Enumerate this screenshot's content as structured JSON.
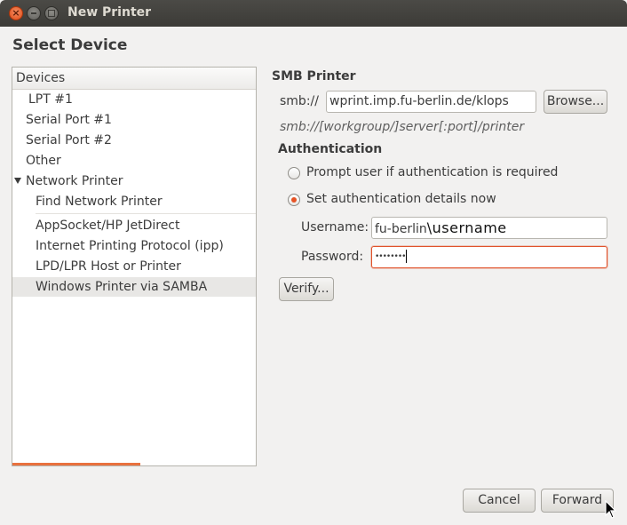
{
  "window": {
    "title": "New Printer"
  },
  "page_title": "Select Device",
  "devices": {
    "header": "Devices",
    "items": [
      {
        "label": "LPT #1"
      },
      {
        "label": "Serial Port #1"
      },
      {
        "label": "Serial Port #2"
      },
      {
        "label": "Other"
      },
      {
        "label": "Network Printer"
      },
      {
        "label": "Find Network Printer"
      },
      {
        "label": "AppSocket/HP JetDirect"
      },
      {
        "label": "Internet Printing Protocol (ipp)"
      },
      {
        "label": "LPD/LPR Host or Printer"
      },
      {
        "label": "Windows Printer via SAMBA"
      }
    ]
  },
  "smb": {
    "section_title": "SMB Printer",
    "prefix": "smb://",
    "uri_value": "wprint.imp.fu-berlin.de/klops",
    "browse_label": "Browse...",
    "hint": "smb://[workgroup/]server[:port]/printer"
  },
  "auth": {
    "section_title": "Authentication",
    "prompt_label": "Prompt user if authentication is required",
    "set_now_label": "Set authentication details now",
    "username_label": "Username:",
    "username_domain": "fu-berlin",
    "username_sep": "\\",
    "username_user": "username",
    "password_label": "Password:",
    "password_mask": "••••••••",
    "verify_label": "Verify..."
  },
  "footer": {
    "cancel_label": "Cancel",
    "forward_label": "Forward"
  },
  "colors": {
    "accent": "#e65325",
    "titlebar": "#3c3b37"
  }
}
